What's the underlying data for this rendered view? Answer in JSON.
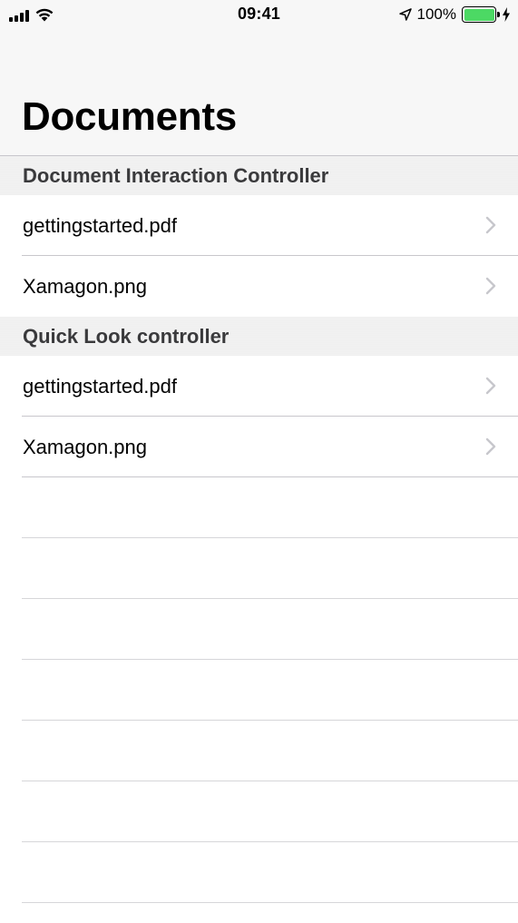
{
  "status_bar": {
    "time": "09:41",
    "battery_percent": "100%",
    "battery_level": 1.0,
    "icons": [
      "signal-icon",
      "wifi-icon",
      "location-icon",
      "battery-icon",
      "charging-bolt-icon"
    ],
    "battery_color": "#4cd964"
  },
  "nav": {
    "title": "Documents"
  },
  "sections": [
    {
      "header": "Document Interaction Controller",
      "rows": [
        {
          "label": "gettingstarted.pdf",
          "accessory": "chevron-right-icon"
        },
        {
          "label": "Xamagon.png",
          "accessory": "chevron-right-icon"
        }
      ]
    },
    {
      "header": "Quick Look controller",
      "rows": [
        {
          "label": "gettingstarted.pdf",
          "accessory": "chevron-right-icon"
        },
        {
          "label": "Xamagon.png",
          "accessory": "chevron-right-icon"
        }
      ]
    }
  ],
  "colors": {
    "separator": "#c8c7cc",
    "section_header_bg": "#f2f2f2",
    "chevron": "#c7c7cc"
  }
}
